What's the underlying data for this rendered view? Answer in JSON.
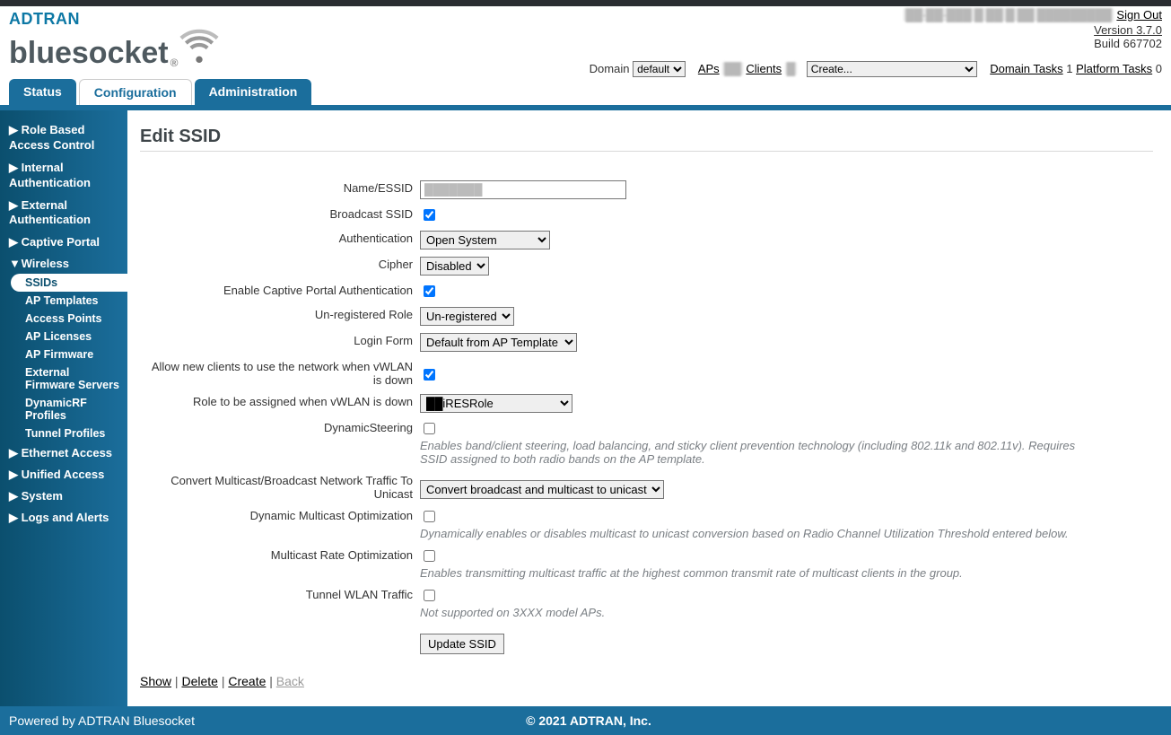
{
  "header": {
    "brand_top": "ADTRAN",
    "brand_bottom": "bluesocket",
    "user_blur": "██-██-███ █ ██ █ ██ █████████",
    "sign_out": "Sign Out",
    "version": "Version 3.7.0",
    "build": "Build 667702",
    "domain_label": "Domain",
    "domain_value": "default",
    "aps_label": "APs",
    "aps_count": "██",
    "clients_label": "Clients",
    "clients_count": "█",
    "create_placeholder": "Create...",
    "domain_tasks_label": "Domain Tasks",
    "domain_tasks_count": "1",
    "platform_tasks_label": "Platform Tasks",
    "platform_tasks_count": "0"
  },
  "tabs": [
    "Status",
    "Configuration",
    "Administration"
  ],
  "sidebar": {
    "items": [
      {
        "label": "Role Based Access Control",
        "arrow": "▶"
      },
      {
        "label": "Internal Authentication",
        "arrow": "▶"
      },
      {
        "label": "External Authentication",
        "arrow": "▶"
      },
      {
        "label": "Captive Portal",
        "arrow": "▶"
      },
      {
        "label": "Wireless",
        "arrow": "▼"
      }
    ],
    "wireless_children": [
      {
        "label": "SSIDs",
        "active": true
      },
      {
        "label": "AP Templates"
      },
      {
        "label": "Access Points"
      },
      {
        "label": "AP Licenses"
      },
      {
        "label": "AP Firmware"
      },
      {
        "label": "External Firmware Servers"
      },
      {
        "label": "DynamicRF Profiles"
      },
      {
        "label": "Tunnel Profiles"
      }
    ],
    "tail": [
      {
        "label": "Ethernet Access",
        "arrow": "▶"
      },
      {
        "label": "Unified Access",
        "arrow": "▶"
      },
      {
        "label": "System",
        "arrow": "▶"
      },
      {
        "label": "Logs and Alerts",
        "arrow": "▶"
      }
    ]
  },
  "page": {
    "title": "Edit SSID",
    "labels": {
      "name": "Name/ESSID",
      "broadcast": "Broadcast SSID",
      "auth": "Authentication",
      "cipher": "Cipher",
      "captive": "Enable Captive Portal Authentication",
      "unreg": "Un-registered Role",
      "loginform": "Login Form",
      "allowdown": "Allow new clients to use the network when vWLAN is down",
      "roledown": "Role to be assigned when vWLAN is down",
      "dynsteer": "DynamicSteering",
      "convert": "Convert Multicast/Broadcast Network Traffic To Unicast",
      "dmo": "Dynamic Multicast Optimization",
      "mro": "Multicast Rate Optimization",
      "tunnel": "Tunnel WLAN Traffic"
    },
    "values": {
      "name": "███████",
      "auth": "Open System",
      "cipher": "Disabled",
      "unreg": "Un-registered",
      "loginform": "Default from AP Template",
      "roledown": "██iRESRole",
      "convert": "Convert broadcast and multicast to unicast"
    },
    "hints": {
      "dynsteer": "Enables band/client steering, load balancing, and sticky client prevention technology (including 802.11k and 802.11v). Requires SSID assigned to both radio bands on the AP template.",
      "dmo": "Dynamically enables or disables multicast to unicast conversion based on Radio Channel Utilization Threshold entered below.",
      "mro": "Enables transmitting multicast traffic at the highest common transmit rate of multicast clients in the group.",
      "tunnel": "Not supported on 3XXX model APs."
    },
    "update_btn": "Update SSID",
    "actions": {
      "show": "Show",
      "delete": "Delete",
      "create": "Create",
      "back": "Back"
    }
  },
  "footer": {
    "left": "Powered by ADTRAN Bluesocket",
    "center": "© 2021 ADTRAN, Inc."
  }
}
